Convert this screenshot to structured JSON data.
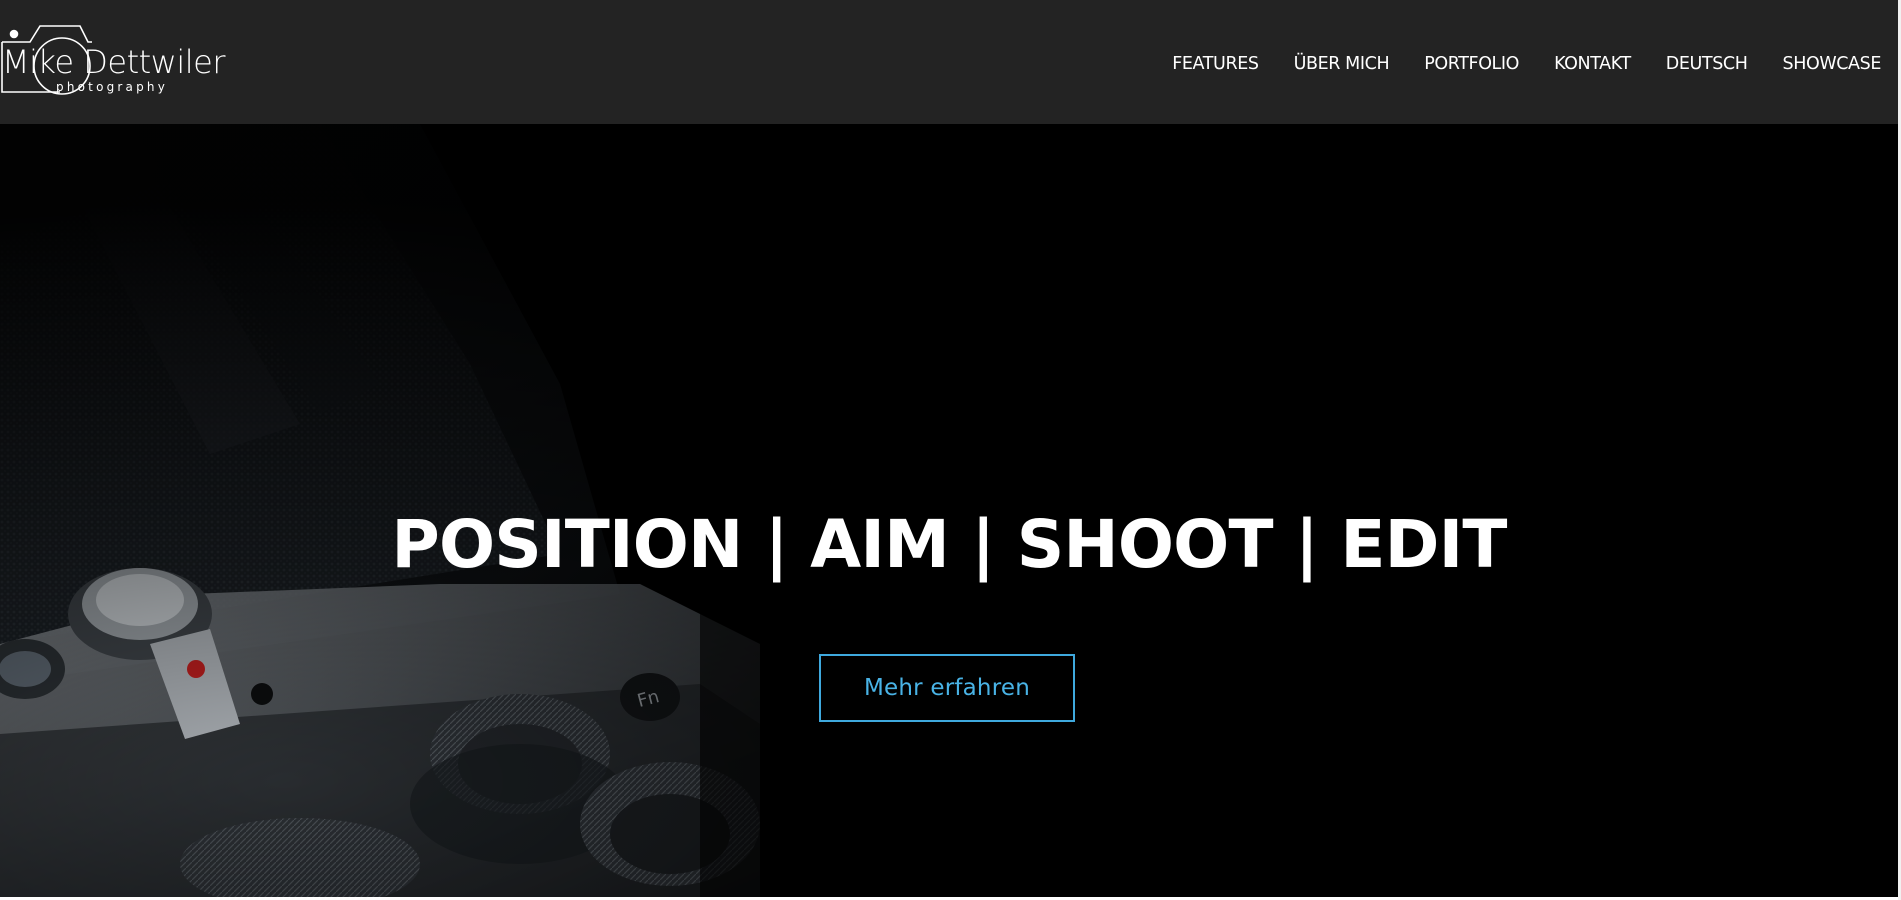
{
  "brand": {
    "name": "Mike Dettwiler",
    "tagline": "photography"
  },
  "nav": {
    "items": [
      {
        "label": "FEATURES"
      },
      {
        "label": "ÜBER MICH"
      },
      {
        "label": "PORTFOLIO"
      },
      {
        "label": "KONTAKT"
      },
      {
        "label": "DEUTSCH"
      },
      {
        "label": "SHOWCASE"
      }
    ]
  },
  "hero": {
    "headline": "POSITION | AIM | SHOOT | EDIT",
    "cta_label": "Mehr erfahren",
    "background_image": "camera-closeup-photo"
  },
  "colors": {
    "topbar_bg": "#232323",
    "hero_bg": "#000000",
    "accent": "#3fa9de",
    "text": "#ffffff"
  }
}
